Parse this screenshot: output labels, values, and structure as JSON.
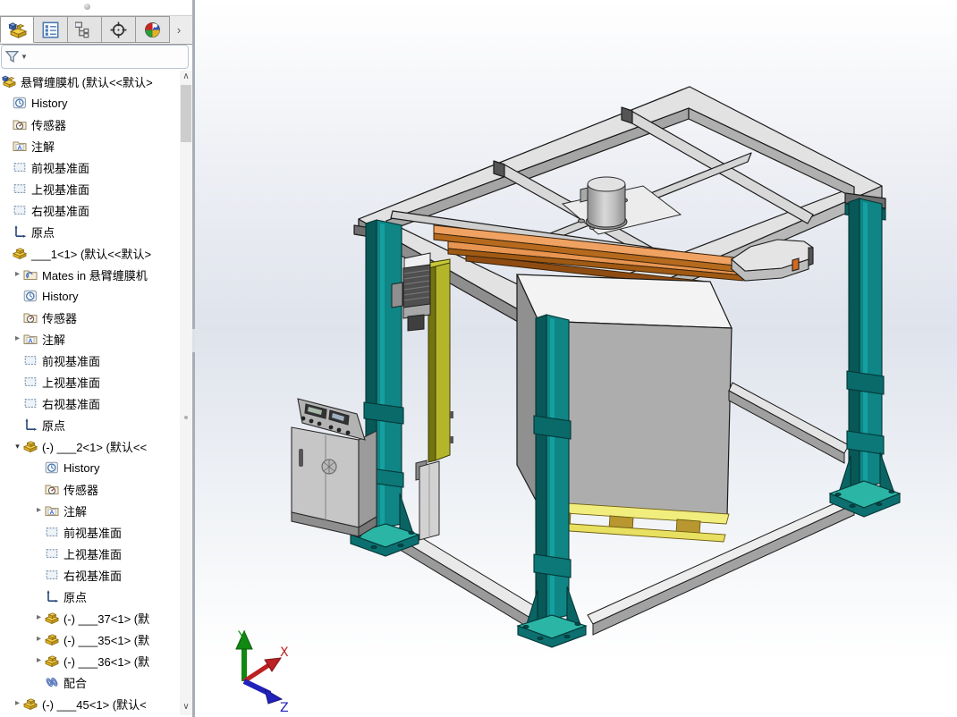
{
  "app": {
    "title": "SolidWorks assembly view"
  },
  "left_panel": {
    "tabs": [
      {
        "id": "featuremanager",
        "icon": "featuremanager-tab-icon",
        "active": true
      },
      {
        "id": "propertymanager",
        "icon": "propertymanager-tab-icon",
        "active": false
      },
      {
        "id": "configurationmanager",
        "icon": "configurationmanager-tab-icon",
        "active": false
      },
      {
        "id": "dimxpertmanager",
        "icon": "dimxpert-tab-icon",
        "active": false
      },
      {
        "id": "displaymanager",
        "icon": "displaymanager-tab-icon",
        "active": false
      }
    ],
    "tabs_overflow_arrow": "›",
    "filter": {
      "icon": "filter-funnel-icon",
      "caret": "▼",
      "value": ""
    },
    "arrow_glyphs": {
      "right": "▸",
      "down": "▾"
    },
    "scrollbar": {
      "up": "∧",
      "down": "∨"
    },
    "tree": {
      "rows": [
        {
          "depth": 0,
          "icon": "assembly-root",
          "label": "悬臂缠膜机 (默认<<默认>"
        },
        {
          "depth": 1,
          "icon": "history",
          "label": "History"
        },
        {
          "depth": 1,
          "icon": "sensors",
          "label": "传感器"
        },
        {
          "depth": 1,
          "icon": "annotations",
          "label": "注解"
        },
        {
          "depth": 1,
          "icon": "plane",
          "label": "前视基准面"
        },
        {
          "depth": 1,
          "icon": "plane",
          "label": "上视基准面"
        },
        {
          "depth": 1,
          "icon": "plane",
          "label": "右视基准面"
        },
        {
          "depth": 1,
          "icon": "origin",
          "label": "原点"
        },
        {
          "depth": 1,
          "icon": "part",
          "label": "___1<1> (默认<<默认>"
        },
        {
          "depth": 2,
          "arrow": "right",
          "icon": "mates-folder",
          "label": "Mates in 悬臂缠膜机"
        },
        {
          "depth": 2,
          "icon": "history",
          "label": "History"
        },
        {
          "depth": 2,
          "icon": "sensors",
          "label": "传感器"
        },
        {
          "depth": 2,
          "arrow": "right",
          "icon": "annotations",
          "label": "注解"
        },
        {
          "depth": 2,
          "icon": "plane",
          "label": "前视基准面"
        },
        {
          "depth": 2,
          "icon": "plane",
          "label": "上视基准面"
        },
        {
          "depth": 2,
          "icon": "plane",
          "label": "右视基准面"
        },
        {
          "depth": 2,
          "icon": "origin",
          "label": "原点"
        },
        {
          "depth": 2,
          "arrow": "down",
          "icon": "part",
          "label": "(-) ___2<1> (默认<<"
        },
        {
          "depth": 3,
          "icon": "history",
          "label": "History"
        },
        {
          "depth": 3,
          "icon": "sensors",
          "label": "传感器"
        },
        {
          "depth": 3,
          "arrow": "right",
          "icon": "annotations",
          "label": "注解"
        },
        {
          "depth": 3,
          "icon": "plane",
          "label": "前视基准面"
        },
        {
          "depth": 3,
          "icon": "plane",
          "label": "上视基准面"
        },
        {
          "depth": 3,
          "icon": "plane",
          "label": "右视基准面"
        },
        {
          "depth": 3,
          "icon": "origin",
          "label": "原点"
        },
        {
          "depth": 3,
          "arrow": "right",
          "icon": "part",
          "label": "(-) ___37<1> (默"
        },
        {
          "depth": 3,
          "arrow": "right",
          "icon": "part",
          "label": "(-) ___35<1> (默"
        },
        {
          "depth": 3,
          "arrow": "right",
          "icon": "part",
          "label": "(-) ___36<1> (默"
        },
        {
          "depth": 3,
          "icon": "mates",
          "label": "配合"
        },
        {
          "depth": 2,
          "arrow": "right",
          "icon": "part",
          "label": "(-) ___45<1> (默认<"
        }
      ]
    }
  },
  "viewport": {
    "triad": {
      "x": "X",
      "y": "Y",
      "z": "Z"
    },
    "background": {
      "edge": "#dfe3ec",
      "center": "#ffffff"
    },
    "machine_colors": {
      "frame_top": "#e2e2e2",
      "frame_side": "#9e9e9e",
      "column_light": "#0f8585",
      "column_dark": "#085858",
      "base_plate": "#2bb5a5",
      "arm_wood": "#f0a263",
      "load_box": "#adadad",
      "pallet": "#f2ee7e",
      "mast": "#b5b52c",
      "cabinet": "#c6c6c6",
      "motor": "#4f4f4f",
      "triad_x": "#bb2222",
      "triad_y": "#118811",
      "triad_z": "#2222bb"
    }
  }
}
